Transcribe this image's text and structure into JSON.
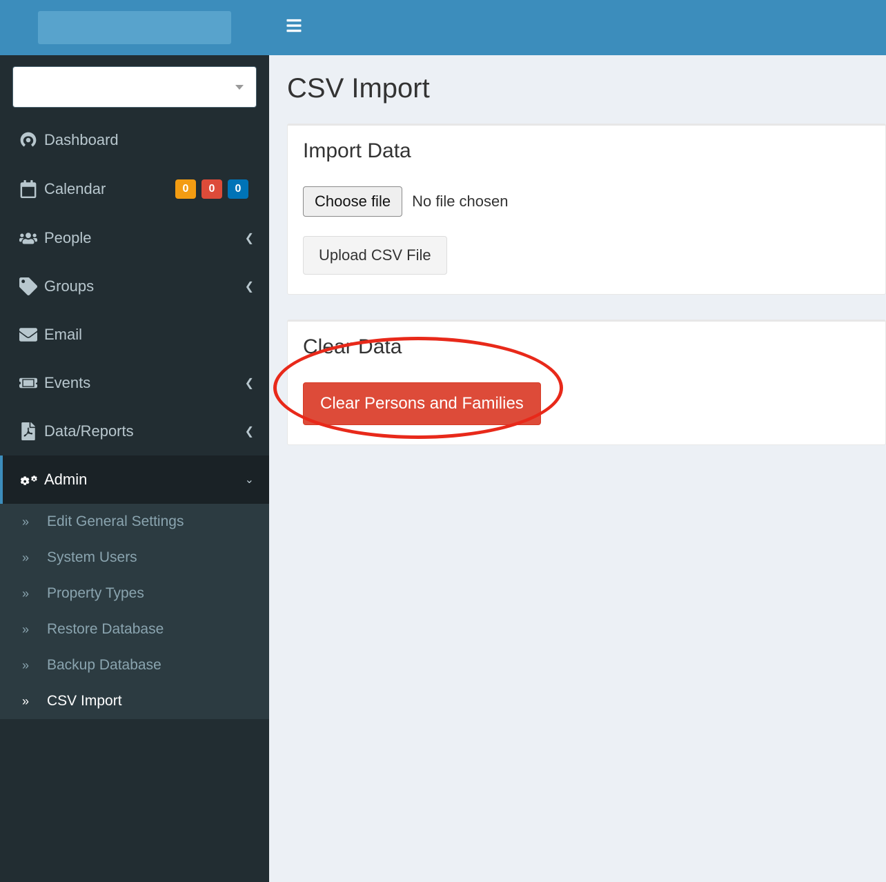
{
  "page": {
    "title": "CSV Import"
  },
  "panels": {
    "import": {
      "header": "Import Data",
      "choose_file_label": "Choose file",
      "file_status": "No file chosen",
      "upload_label": "Upload CSV File"
    },
    "clear": {
      "header": "Clear Data",
      "clear_button_label": "Clear Persons and Families"
    }
  },
  "sidebar": {
    "items": [
      {
        "label": "Dashboard"
      },
      {
        "label": "Calendar",
        "badges": [
          "0",
          "0",
          "0"
        ]
      },
      {
        "label": "People"
      },
      {
        "label": "Groups"
      },
      {
        "label": "Email"
      },
      {
        "label": "Events"
      },
      {
        "label": "Data/Reports"
      },
      {
        "label": "Admin"
      }
    ],
    "admin_sub": [
      {
        "label": "Edit General Settings"
      },
      {
        "label": "System Users"
      },
      {
        "label": "Property Types"
      },
      {
        "label": "Restore Database"
      },
      {
        "label": "Backup Database"
      },
      {
        "label": "CSV Import"
      }
    ]
  }
}
